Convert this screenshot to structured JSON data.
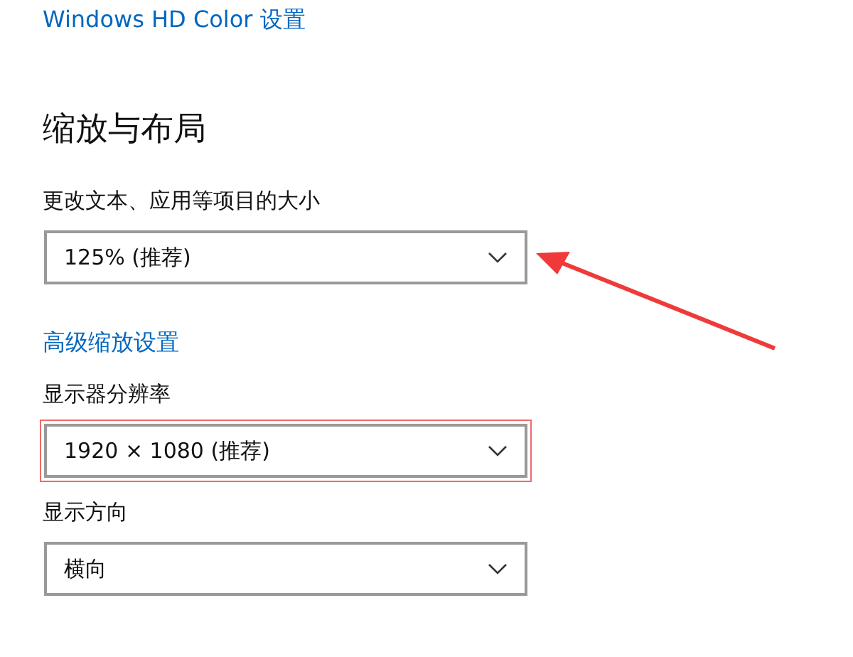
{
  "items": [
    {
      "kind": "link",
      "text": "Windows HD Color 设置"
    },
    {
      "kind": "heading",
      "text": "缩放与布局"
    },
    {
      "kind": "label",
      "text": "更改文本、应用等项目的大小"
    },
    {
      "kind": "dropdown",
      "value": "125% (推荐)",
      "highlighted": false,
      "pointed": true
    },
    {
      "kind": "link",
      "text": "高级缩放设置"
    },
    {
      "kind": "label",
      "text": "显示器分辨率"
    },
    {
      "kind": "dropdown",
      "value": "1920 × 1080 (推荐)",
      "highlighted": true,
      "pointed": false
    },
    {
      "kind": "label",
      "text": "显示方向"
    },
    {
      "kind": "dropdown",
      "value": "横向",
      "highlighted": false,
      "pointed": false
    }
  ]
}
